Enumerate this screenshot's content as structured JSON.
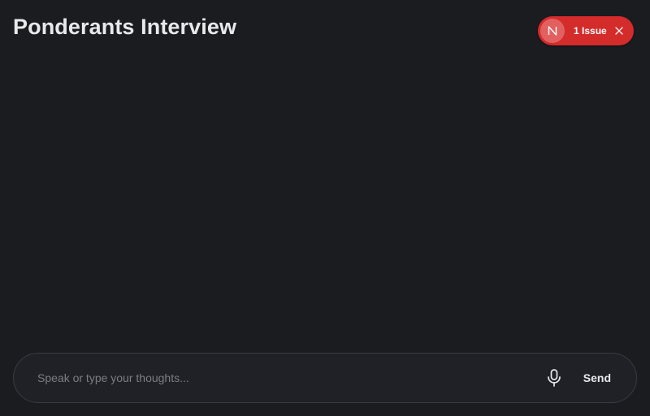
{
  "header": {
    "title": "Ponderants Interview"
  },
  "issue_badge": {
    "avatar_letter": "N",
    "label": "1 Issue",
    "icon": "close-icon",
    "color": "#d42b2b"
  },
  "composer": {
    "input_value": "",
    "placeholder": "Speak or type your thoughts...",
    "mic_icon": "microphone-icon",
    "send_label": "Send"
  },
  "colors": {
    "background": "#1b1c20",
    "composer_background": "#202126",
    "composer_border": "#3a3b41",
    "text": "#e9e9ec",
    "placeholder": "#7c7d84"
  }
}
